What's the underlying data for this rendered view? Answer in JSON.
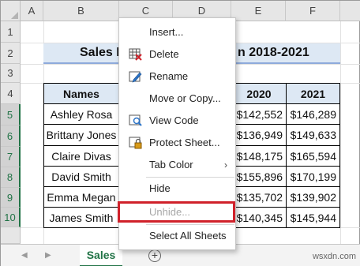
{
  "columns": [
    "A",
    "B",
    "C",
    "D",
    "E",
    "F"
  ],
  "rows": [
    "1",
    "2",
    "3",
    "4",
    "5",
    "6",
    "7",
    "8",
    "9",
    "10"
  ],
  "title": "Sales M",
  "title_tail": "n 2018-2021",
  "table": {
    "headers": [
      "Names",
      "2020",
      "2021"
    ],
    "rows": [
      {
        "name": "Ashley Rosa",
        "v2020": "$142,552",
        "v2021": "$146,289"
      },
      {
        "name": "Brittany Jones",
        "v2020": "$136,949",
        "v2021": "$149,633"
      },
      {
        "name": "Claire Divas",
        "v2020": "$148,175",
        "v2021": "$165,594"
      },
      {
        "name": "David Smith",
        "v2020": "$155,896",
        "v2021": "$170,199"
      },
      {
        "name": "Emma Megan",
        "v2020": "$135,702",
        "v2021": "$139,902"
      },
      {
        "name": "James Smith",
        "v2020": "$140,345",
        "v2021": "$145,944"
      }
    ]
  },
  "context_menu": {
    "items": [
      {
        "label": "Insert...",
        "icon": "none",
        "disabled": false
      },
      {
        "label": "Delete",
        "icon": "delete-sheet-icon",
        "disabled": false
      },
      {
        "label": "Rename",
        "icon": "rename-icon",
        "disabled": false
      },
      {
        "label": "Move or Copy...",
        "icon": "none",
        "disabled": false
      },
      {
        "label": "View Code",
        "icon": "view-code-icon",
        "disabled": false
      },
      {
        "label": "Protect Sheet...",
        "icon": "protect-sheet-icon",
        "disabled": false
      },
      {
        "label": "Tab Color",
        "icon": "none",
        "disabled": false,
        "submenu": true
      },
      {
        "label": "Hide",
        "icon": "none",
        "disabled": false
      },
      {
        "label": "Unhide...",
        "icon": "none",
        "disabled": true
      },
      {
        "label": "Select All Sheets",
        "icon": "none",
        "disabled": false
      }
    ],
    "submenu_arrow": "›"
  },
  "sheet_tab": "Sales",
  "add_sheet": "+",
  "watermark": "wsxdn.com",
  "colors": {
    "accent_green": "#217346",
    "highlight_red": "#d0212a",
    "header_fill": "#dde8f4"
  }
}
